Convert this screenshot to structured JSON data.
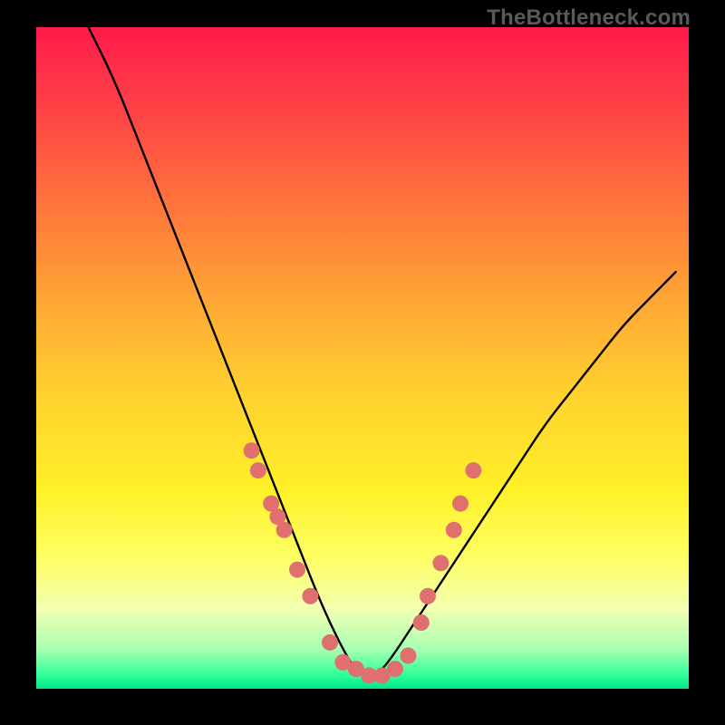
{
  "domain": "Chart",
  "watermark": "TheBottleneck.com",
  "chart_data": {
    "type": "line",
    "title": "",
    "xlabel": "",
    "ylabel": "",
    "xlim": [
      0,
      100
    ],
    "ylim": [
      0,
      100
    ],
    "grid": false,
    "legend": false,
    "background": "rainbow-vertical",
    "curve_description": "V-shaped bottleneck curve; black line from top-left sweeping down to a flat minimum near x≈45-55%, then rising to the right. Pink dots mark sampled hardware points clustered near and around the minimum.",
    "series": [
      {
        "name": "bottleneck-curve",
        "x": [
          8,
          12,
          16,
          20,
          24,
          28,
          32,
          36,
          40,
          44,
          48,
          50,
          52,
          54,
          58,
          62,
          66,
          70,
          74,
          78,
          82,
          86,
          90,
          94,
          98
        ],
        "y": [
          100,
          92,
          82,
          72,
          62,
          52,
          42,
          32,
          22,
          12,
          4,
          2,
          2,
          4,
          10,
          16,
          22,
          28,
          34,
          40,
          45,
          50,
          55,
          59,
          63
        ]
      }
    ],
    "points": {
      "name": "sampled-dots",
      "approx": true,
      "x": [
        33,
        34,
        36,
        37,
        38,
        40,
        42,
        45,
        47,
        49,
        51,
        53,
        55,
        57,
        59,
        60,
        62,
        64,
        65,
        67
      ],
      "y": [
        36,
        33,
        28,
        26,
        24,
        18,
        14,
        7,
        4,
        3,
        2,
        2,
        3,
        5,
        10,
        14,
        19,
        24,
        28,
        33
      ]
    }
  }
}
